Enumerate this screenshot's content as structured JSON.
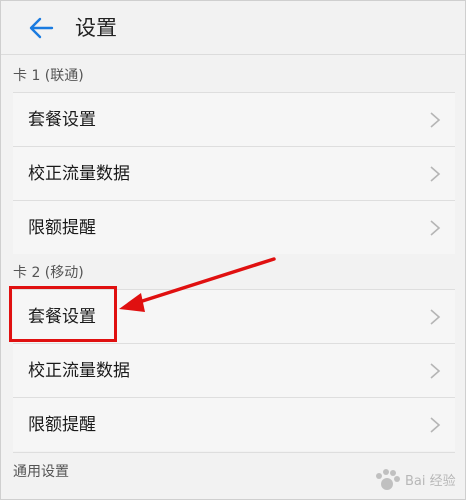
{
  "header": {
    "title": "设置",
    "back_icon": "arrow-left-icon",
    "accent": "#1a7be0"
  },
  "sections": [
    {
      "title": "卡 1 (联通)",
      "items": [
        "套餐设置",
        "校正流量数据",
        "限额提醒"
      ]
    },
    {
      "title": "卡 2 (移动)",
      "items": [
        "套餐设置",
        "校正流量数据",
        "限额提醒"
      ]
    },
    {
      "title": "通用设置",
      "items": []
    }
  ],
  "annotation": {
    "color": "#e01010",
    "target": "套餐设置"
  },
  "watermark": {
    "text": "Bai 经验",
    "logo": "baidu-paw-logo"
  }
}
